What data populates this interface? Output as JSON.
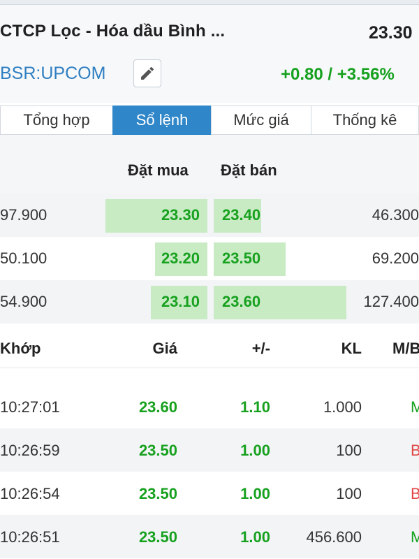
{
  "header": {
    "company_name": "CTCP Lọc - Hóa dầu Bình ...",
    "price": "23.30",
    "ticker": "BSR:UPCOM",
    "change": "+0.80 / +3.56%",
    "edit_icon": "pencil-icon"
  },
  "tabs": [
    {
      "label": "Tổng hợp",
      "active": false
    },
    {
      "label": "Sổ lệnh",
      "active": true
    },
    {
      "label": "Mức giá",
      "active": false
    },
    {
      "label": "Thống kê",
      "active": false
    }
  ],
  "orderbook": {
    "buy_header": "Đặt mua",
    "sell_header": "Đặt bán",
    "rows": [
      {
        "bid_volume": "97.900",
        "bid_price": "23.30",
        "ask_price": "23.40",
        "ask_volume": "46.300"
      },
      {
        "bid_volume": "50.100",
        "bid_price": "23.20",
        "ask_price": "23.50",
        "ask_volume": "69.200"
      },
      {
        "bid_volume": "54.900",
        "bid_price": "23.10",
        "ask_price": "23.60",
        "ask_volume": "127.400"
      }
    ]
  },
  "trades": {
    "headers": {
      "time": "Khớp",
      "price": "Giá",
      "change": "+/-",
      "volume": "KL",
      "side": "M/B"
    },
    "rows": [
      {
        "time": "10:27:01",
        "price": "23.60",
        "change": "1.10",
        "volume": "1.000",
        "side": "M"
      },
      {
        "time": "10:26:59",
        "price": "23.50",
        "change": "1.00",
        "volume": "100",
        "side": "B"
      },
      {
        "time": "10:26:54",
        "price": "23.50",
        "change": "1.00",
        "volume": "100",
        "side": "B"
      },
      {
        "time": "10:26:51",
        "price": "23.50",
        "change": "1.00",
        "volume": "456.600",
        "side": "M"
      }
    ]
  },
  "colors": {
    "up_green": "#17a11f",
    "sell_red": "#e04848",
    "accent_blue": "#2f86c8",
    "ticker_blue": "#2f7fc1",
    "depth_bar": "#c8ebc4"
  }
}
